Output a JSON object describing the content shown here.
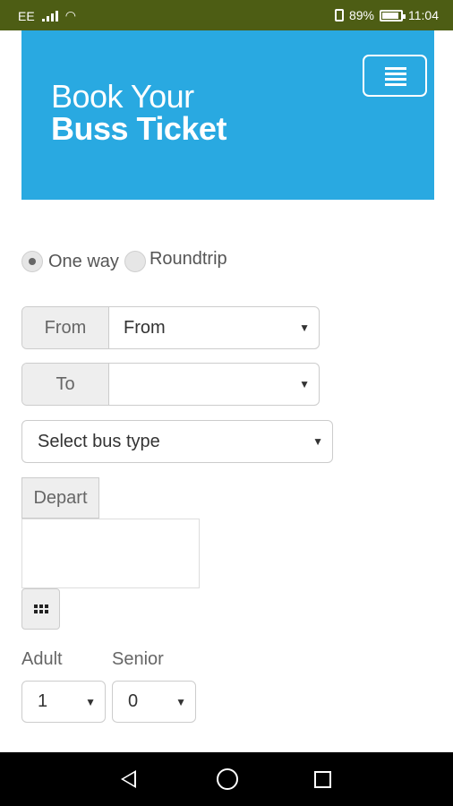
{
  "status_bar": {
    "carrier": "EE",
    "battery": "89%",
    "time": "11:04"
  },
  "header": {
    "title_line1": "Book Your",
    "title_line2": "Buss Ticket",
    "menu_icon": "hamburger-icon"
  },
  "trip_type": {
    "selected": "One way",
    "options": [
      "One way",
      "Roundtrip"
    ]
  },
  "from": {
    "label": "From",
    "value": "From"
  },
  "to": {
    "label": "To",
    "value": ""
  },
  "bus_type": {
    "value": "Select bus type"
  },
  "depart": {
    "label": "Depart",
    "value": "",
    "calendar_icon": "calendar-grid-icon"
  },
  "passengers": {
    "adult_label": "Adult",
    "adult_value": "1",
    "senior_label": "Senior",
    "senior_value": "0"
  },
  "colors": {
    "status_bar": "#4d5d14",
    "hero": "#29a9e1",
    "nav_bar": "#000000"
  }
}
